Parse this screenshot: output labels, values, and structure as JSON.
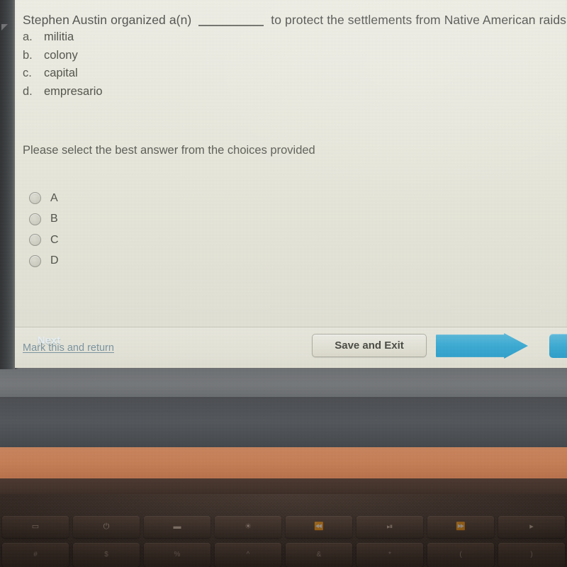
{
  "quiz": {
    "question": {
      "prefix": "Stephen Austin organized a(n)",
      "blank": "__________",
      "suffix": "to protect the settlements from Native American raids."
    },
    "choices": [
      {
        "letter": "a.",
        "text": "militia"
      },
      {
        "letter": "b.",
        "text": "colony"
      },
      {
        "letter": "c.",
        "text": "capital"
      },
      {
        "letter": "d.",
        "text": "empresario"
      }
    ],
    "instruction": "Please select the best answer from the choices provided",
    "answer_options": [
      {
        "label": "A",
        "selected": false
      },
      {
        "label": "B",
        "selected": false
      },
      {
        "label": "C",
        "selected": false
      },
      {
        "label": "D",
        "selected": false
      }
    ],
    "footer": {
      "mark_link": "Mark this and return",
      "save_button": "Save and Exit",
      "next_button": "Next"
    },
    "colors": {
      "page_background": "#ecece2",
      "text": "#4c4d49",
      "link": "#7f9aa6",
      "accent_blue": "#3eb3de",
      "button_face": "#eeede1"
    }
  },
  "laptop": {
    "function_keys": [
      {
        "name": "display-key",
        "glyph": "▭"
      },
      {
        "name": "power-key",
        "glyph": "⏻"
      },
      {
        "name": "brightness-down-key",
        "glyph": "▬"
      },
      {
        "name": "brightness-up-key",
        "glyph": "☀"
      },
      {
        "name": "rewind-key",
        "glyph": "⏪"
      },
      {
        "name": "play-pause-key",
        "glyph": "⏯"
      },
      {
        "name": "fast-forward-key",
        "glyph": "⏩"
      },
      {
        "name": "volume-key",
        "glyph": "▸"
      }
    ],
    "number_keys": [
      {
        "name": "key-hash",
        "glyph": "#"
      },
      {
        "name": "key-dollar",
        "glyph": "$"
      },
      {
        "name": "key-percent",
        "glyph": "%"
      },
      {
        "name": "key-caret",
        "glyph": "^"
      },
      {
        "name": "key-ampersand",
        "glyph": "&"
      },
      {
        "name": "key-asterisk",
        "glyph": "*"
      },
      {
        "name": "key-paren",
        "glyph": "("
      },
      {
        "name": "key-paren-close",
        "glyph": ")"
      }
    ],
    "colors": {
      "bezel": "#3d4042",
      "lid_gray": "#6e7072",
      "hinge_dark": "#4a4d51",
      "copper_strip": "#c9845c",
      "deck_dark": "#33261f"
    }
  }
}
